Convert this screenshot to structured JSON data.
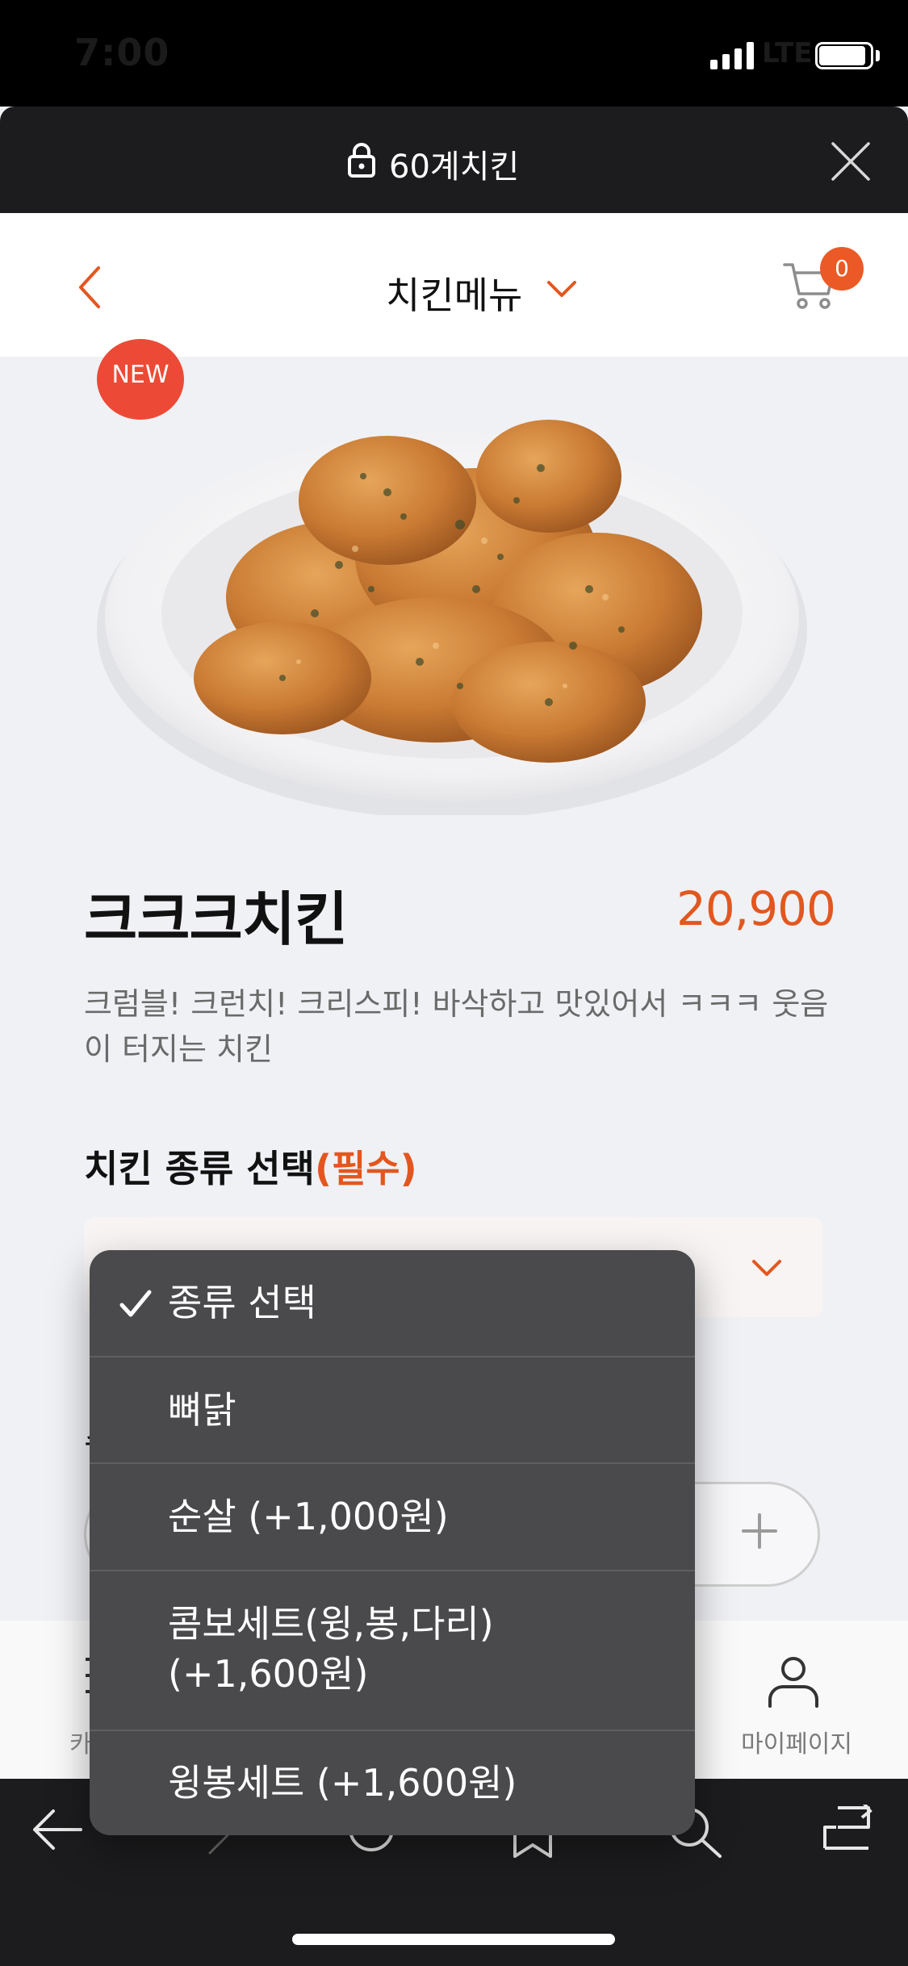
{
  "status_bar": {
    "time": "7:00",
    "network": "LTE"
  },
  "browser": {
    "site_title": "60계치킨"
  },
  "header": {
    "title": "치킨메뉴",
    "cart_count": "0"
  },
  "product": {
    "badge": "NEW",
    "name": "크크크치킨",
    "price": "20,900",
    "description": "크럼블! 크런치! 크리스피! 바삭하고 맛있어서 ㅋㅋㅋ 웃음이 터지는 치킨"
  },
  "option": {
    "label": "치킨 종류 선택",
    "required": "(필수)"
  },
  "dropdown": {
    "selected_index": 0,
    "items": [
      {
        "label": "종류 선택"
      },
      {
        "label": "뼈닭"
      },
      {
        "label": "순살 (+1,000원)"
      },
      {
        "label": "콤보세트(윙,봉,다리)\n(+1,600원)"
      },
      {
        "label": "윙봉세트 (+1,600원)"
      }
    ]
  },
  "bottom_nav": {
    "mypage_label": "마이페이지",
    "category_label_partial": "카"
  },
  "quantity": {
    "label_partial": "수"
  },
  "colors": {
    "accent": "#e2571f",
    "badge": "#ec4a36",
    "dropdown_bg": "#4a4a4c"
  }
}
